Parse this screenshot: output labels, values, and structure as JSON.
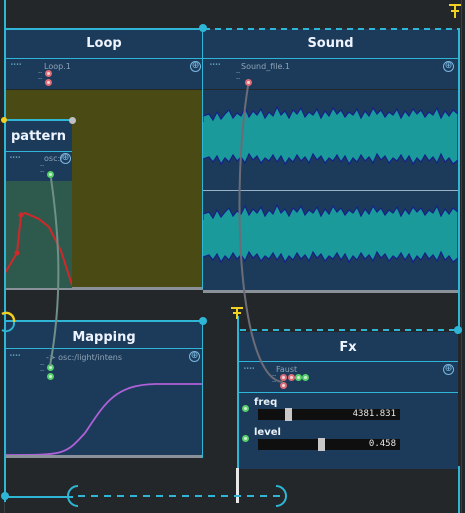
{
  "colors": {
    "accent": "#2fb6d6",
    "box_bg": "#1c3b5a",
    "loop_bg": "#4a4a14",
    "port_pink": "#e06a76",
    "port_green": "#56d06a",
    "wave": "#1a9a9a",
    "trigger": "#f0d020",
    "curve": "#b060d8"
  },
  "loop": {
    "title": "Loop",
    "process": "Loop.1"
  },
  "sound": {
    "title": "Sound",
    "process": "Sound_file.1"
  },
  "pattern": {
    "title": "pattern",
    "process": "osc:/"
  },
  "mapping": {
    "title": "Mapping",
    "process": "-> osc:/light/intens"
  },
  "fx": {
    "title": "Fx",
    "process": "Faust",
    "params": [
      {
        "label": "freq",
        "value": "4381.831",
        "fraction": 0.21
      },
      {
        "label": "level",
        "value": "0.458",
        "fraction": 0.458
      }
    ]
  },
  "icons": {
    "plus": "⊕",
    "dots": "∴∵",
    "trigger": "trigger-t-icon"
  }
}
